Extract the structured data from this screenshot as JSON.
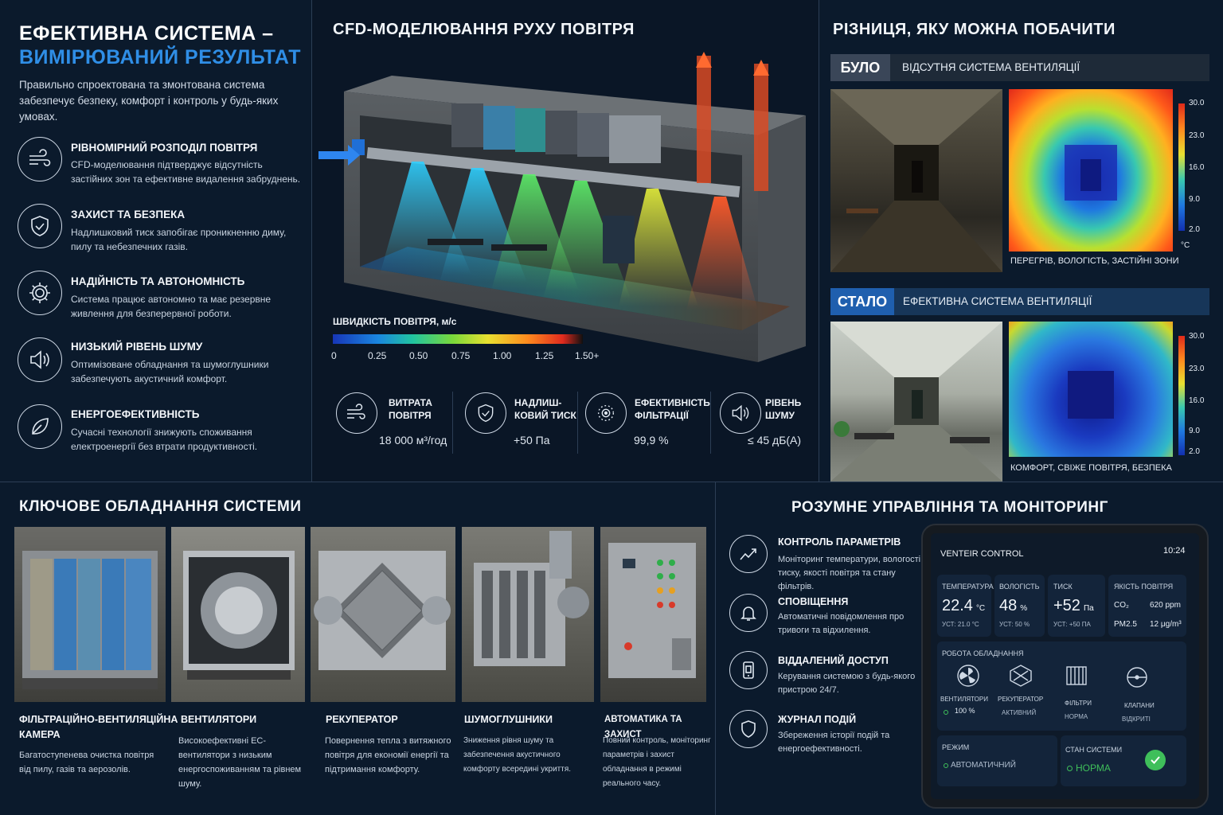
{
  "intro": {
    "title_line1": "ЕФЕКТИВНА СИСТЕМА –",
    "title_line2": "ВИМІРЮВАНИЙ РЕЗУЛЬТАТ",
    "text": "Правильно спроектована та змонтована система забезпечує безпеку, комфорт і контроль у будь-яких умовах.",
    "features": [
      {
        "icon": "wind-icon",
        "title": "РІВНОМІРНИЙ РОЗПОДІЛ ПОВІТРЯ",
        "text": "CFD-моделювання підтверджує відсутність застійних зон та ефективне видалення забруднень."
      },
      {
        "icon": "shield-check-icon",
        "title": "ЗАХИСТ ТА БЕЗПЕКА",
        "text": "Надлишковий тиск запобігає проникненню диму, пилу та небезпечних газів."
      },
      {
        "icon": "gear-icon",
        "title": "НАДІЙНІСТЬ ТА АВТОНОМНІСТЬ",
        "text": "Система працює автономно та має резервне живлення для безперервної роботи."
      },
      {
        "icon": "speaker-icon",
        "title": "НИЗЬКИЙ РІВЕНЬ ШУМУ",
        "text": "Оптимізоване обладнання та шумоглушники забезпечують акустичний комфорт."
      },
      {
        "icon": "leaf-icon",
        "title": "ЕНЕРГОЕФЕКТИВНІСТЬ",
        "text": "Сучасні технології знижують споживання електроенергії без втрати продуктивності."
      }
    ]
  },
  "cfd": {
    "title": "CFD-МОДЕЛЮВАННЯ РУХУ ПОВІТРЯ",
    "scale_label": "ШВИДКІСТЬ ПОВІТРЯ, м/с",
    "scale_ticks": [
      "0",
      "0.25",
      "0.50",
      "0.75",
      "1.00",
      "1.25",
      "1.50+"
    ],
    "metrics": [
      {
        "icon": "airflow-icon",
        "label_l1": "ВИТРАТА",
        "label_l2": "ПОВІТРЯ",
        "value": "18 000 м³/год"
      },
      {
        "icon": "shield-icon",
        "label_l1": "НАДЛИШ-",
        "label_l2": "КОВИЙ ТИСК",
        "value": "+50 Па"
      },
      {
        "icon": "filter-icon",
        "label_l1": "ЕФЕКТИВНІСТЬ",
        "label_l2": "ФІЛЬТРАЦІЇ",
        "value": "99,9 %"
      },
      {
        "icon": "speaker-icon",
        "label_l1": "РІВЕНЬ",
        "label_l2": "ШУМУ",
        "value": "≤ 45 дБ(А)"
      }
    ]
  },
  "compare": {
    "title": "РІЗНИЦЯ, ЯКУ МОЖНА ПОБАЧИТИ",
    "before": {
      "tag": "БУЛО",
      "label": "ВІДСУТНЯ СИСТЕМА ВЕНТИЛЯЦІЇ",
      "caption": "ПЕРЕГРІВ, ВОЛОГІСТЬ, ЗАСТІЙНІ ЗОНИ"
    },
    "after": {
      "tag": "СТАЛО",
      "label": "ЕФЕКТИВНА СИСТЕМА ВЕНТИЛЯЦІЇ",
      "caption": "КОМФОРТ, СВІЖЕ ПОВІТРЯ, БЕЗПЕКА"
    },
    "thermo_ticks": [
      "30.0",
      "23.0",
      "16.0",
      "9.0",
      "2.0"
    ],
    "thermo_unit": "°C",
    "colors": {
      "after_tag_bg": "#1f5fae",
      "before_tag_bg": "#3a4658"
    }
  },
  "equipment": {
    "title": "КЛЮЧОВЕ ОБЛАДНАННЯ СИСТЕМИ",
    "items": [
      {
        "title_l1": "ФІЛЬТРАЦІЙНО-ВЕНТИЛЯЦІЙНА",
        "title_l2": "КАМЕРА",
        "text": "Багатоступенева очистка повітря від пилу, газів та аерозолів."
      },
      {
        "title_l1": "ВЕНТИЛЯТОРИ",
        "title_l2": "",
        "text": "Високоефективні ЕС-вентилятори з низьким енергоспоживанням та рівнем шуму."
      },
      {
        "title_l1": "РЕКУПЕРАТОР",
        "title_l2": "",
        "text": "Повернення тепла з витяжного повітря для економії енергії та підтримання комфорту."
      },
      {
        "title_l1": "ШУМОГЛУШНИКИ",
        "title_l2": "",
        "text": "Зниження рівня шуму та забезпечення акустичного комфорту всередині укриття."
      },
      {
        "title_l1": "АВТОМАТИКА ТА ЗАХИСТ",
        "title_l2": "",
        "text": "Повний контроль, моніторинг параметрів і захист обладнання в режимі реального часу."
      }
    ]
  },
  "control": {
    "title": "РОЗУМНЕ УПРАВЛІННЯ ТА МОНІТОРИНГ",
    "items": [
      {
        "icon": "chart-icon",
        "title": "КОНТРОЛЬ ПАРАМЕТРІВ",
        "text": "Моніторинг температури, вологості, тиску, якості повітря та стану фільтрів."
      },
      {
        "icon": "bell-icon",
        "title": "СПОВІЩЕННЯ",
        "text": "Автоматичні повідомлення про тривоги та відхилення."
      },
      {
        "icon": "phone-icon",
        "title": "ВІДДАЛЕНИЙ ДОСТУП",
        "text": "Керування системою з будь-якого пристрою 24/7."
      },
      {
        "icon": "shield-icon",
        "title": "ЖУРНАЛ ПОДІЙ",
        "text": "Збереження історії подій та енергоефективності."
      }
    ],
    "tablet": {
      "app_name": "VENTEIR CONTROL",
      "time": "10:24",
      "cards": [
        {
          "label": "ТЕМПЕРАТУРА",
          "value": "22.4",
          "unit": "°C",
          "sub": "УСТ: 21.0 °C"
        },
        {
          "label": "ВОЛОГІСТЬ",
          "value": "48",
          "unit": "%",
          "sub": "УСТ: 50 %"
        },
        {
          "label": "ТИСК",
          "value": "+52",
          "unit": "Па",
          "sub": "УСТ: +50 Па"
        }
      ],
      "air_quality": {
        "label": "ЯКІСТЬ ПОВІТРЯ",
        "co2_label": "CO₂",
        "co2_value": "620 ppm",
        "pm_label": "PM2.5",
        "pm_value": "12 μg/m³"
      },
      "equipment_label": "РОБОТА ОБЛАДНАННЯ",
      "equipment": [
        {
          "icon": "fan-icon",
          "name": "ВЕНТИЛЯТОРИ",
          "status": "100 %"
        },
        {
          "icon": "recuperator-icon",
          "name": "РЕКУПЕРАТОР",
          "status": "АКТИВНИЙ"
        },
        {
          "icon": "filter-icon",
          "name": "ФІЛЬТРИ",
          "status": "НОРМА"
        },
        {
          "icon": "valve-icon",
          "name": "КЛАПАНИ",
          "status": "ВІДКРИТІ"
        }
      ],
      "mode_label": "РЕЖИМ",
      "mode_value": "АВТОМАТИЧНИЙ",
      "system_label": "СТАН СИСТЕМИ",
      "system_value": "НОРМА",
      "colors": {
        "ok": "#3fbf5a"
      }
    }
  }
}
